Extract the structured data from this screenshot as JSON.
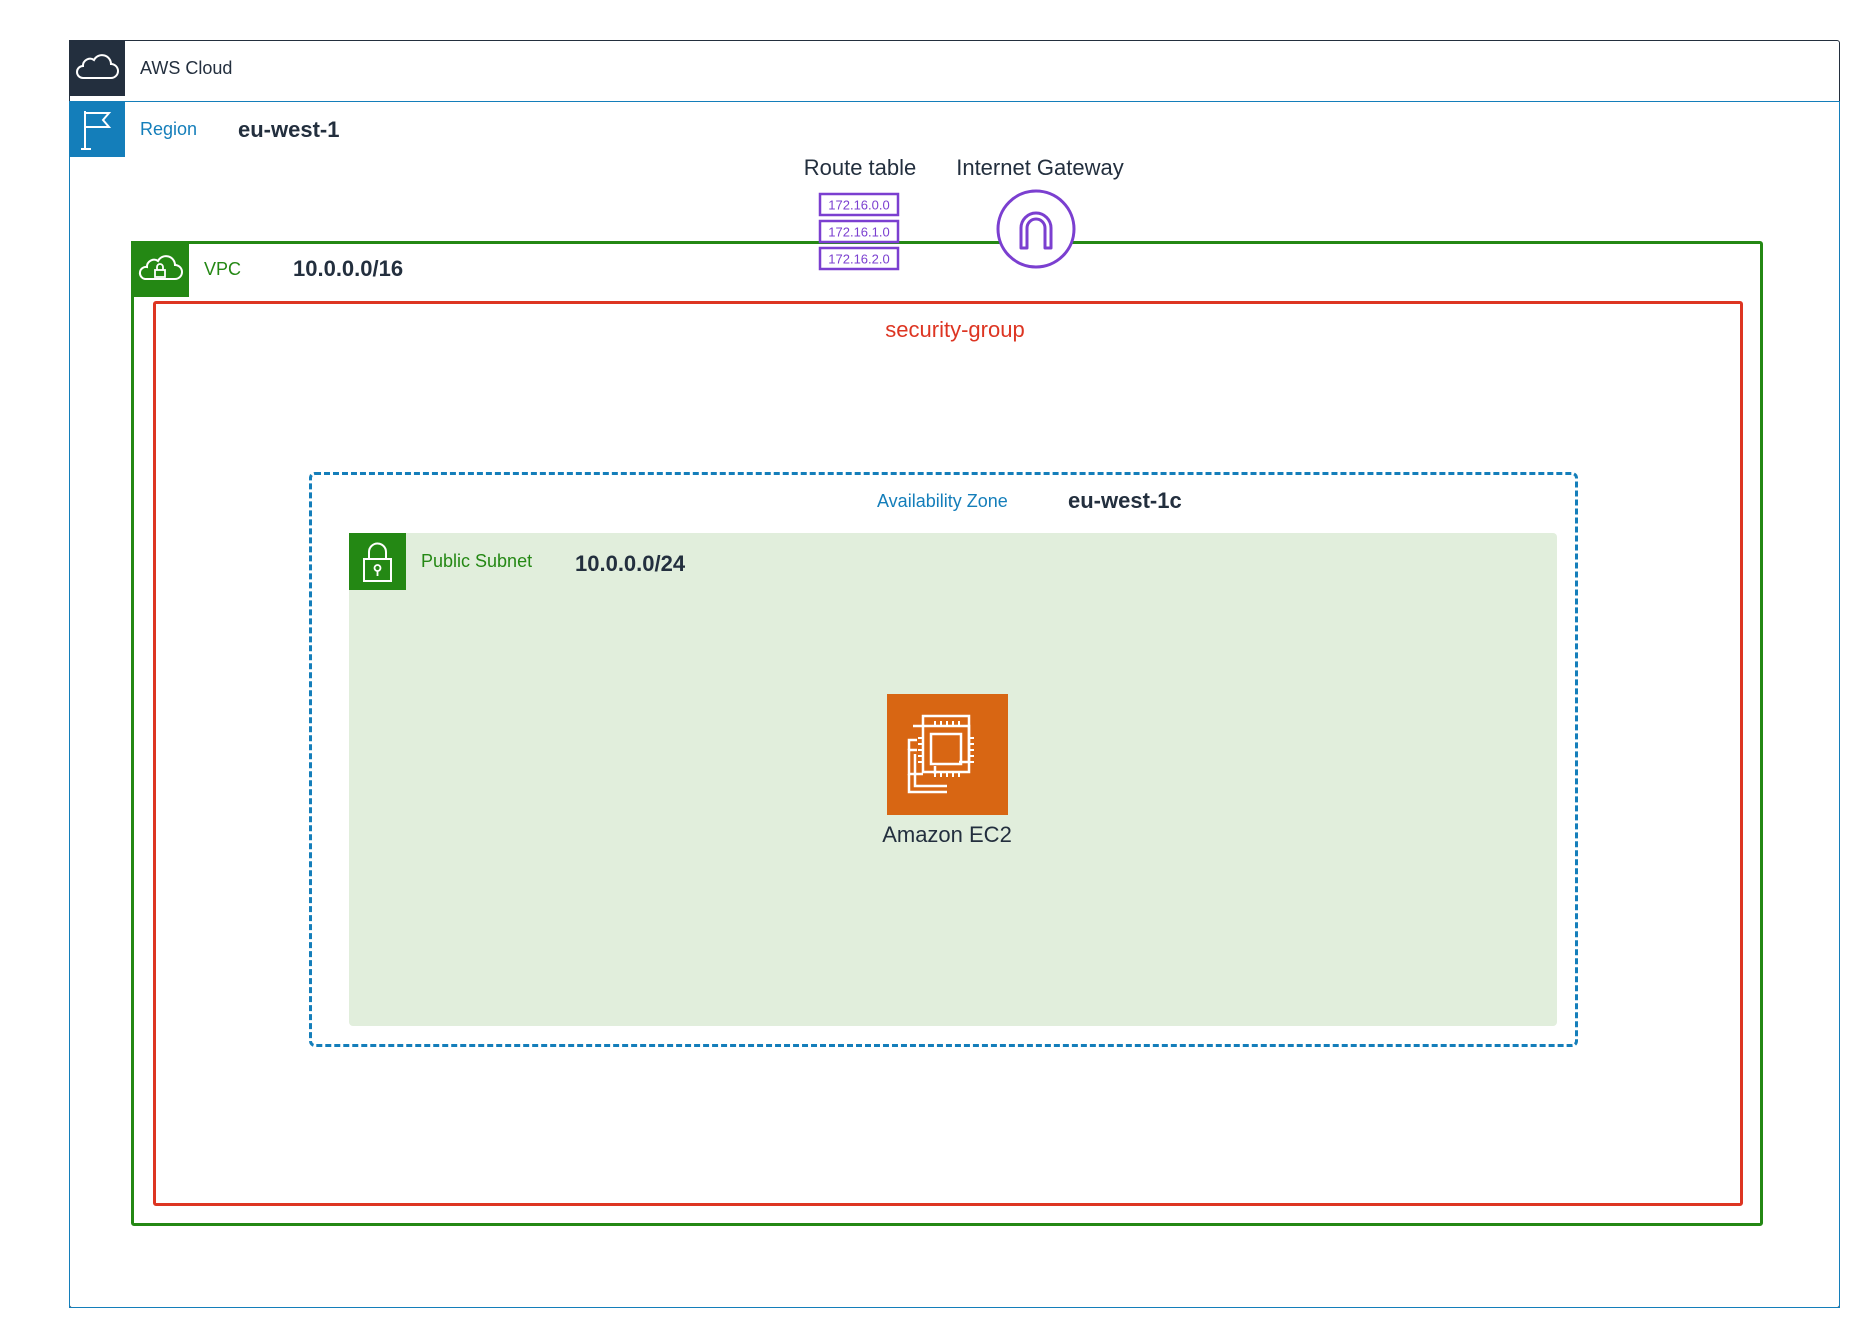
{
  "cloud": {
    "label": "AWS Cloud",
    "icon": "cloud-icon",
    "color": "#232f3e"
  },
  "region": {
    "label": "Region",
    "value": "eu-west-1",
    "icon": "flag-icon",
    "color": "#147eba"
  },
  "route_table": {
    "label": "Route table",
    "entries": [
      "172.16.0.0",
      "172.16.1.0",
      "172.16.2.0"
    ],
    "icon": "route-table-icon",
    "color": "#7b3fd0"
  },
  "internet_gateway": {
    "label": "Internet Gateway",
    "icon": "internet-gateway-icon",
    "color": "#7b3fd0"
  },
  "vpc": {
    "label": "VPC",
    "value": "10.0.0.0/16",
    "icon": "cloud-lock-icon",
    "color": "#248814"
  },
  "security_group": {
    "label": "security-group",
    "color": "#dd3522"
  },
  "availability_zone": {
    "label": "Availability Zone",
    "value": "eu-west-1c",
    "color": "#147eba"
  },
  "subnet": {
    "label": "Public Subnet",
    "value": "10.0.0.0/24",
    "icon": "padlock-icon",
    "color": "#248814",
    "fill": "#e1eedc"
  },
  "ec2": {
    "label": "Amazon EC2",
    "icon": "ec2-chip-icon",
    "color": "#d86613"
  }
}
